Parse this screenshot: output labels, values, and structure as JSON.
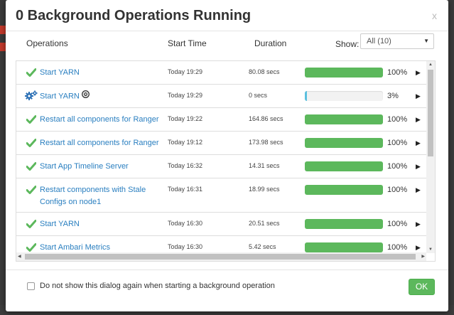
{
  "dialog": {
    "title": "0 Background Operations Running",
    "close_label": "x"
  },
  "columns": {
    "operations": "Operations",
    "start_time": "Start Time",
    "duration": "Duration",
    "show_label": "Show:"
  },
  "show_select": {
    "value": "All (10)"
  },
  "operations": [
    {
      "name": "Start YARN",
      "start": "Today 19:29",
      "duration": "80.08 secs",
      "progress": 100,
      "percent_label": "100%",
      "status": "success",
      "cancellable": false
    },
    {
      "name": "Start YARN",
      "start": "Today 19:29",
      "duration": "0 secs",
      "progress": 3,
      "percent_label": "3%",
      "status": "running",
      "cancellable": true
    },
    {
      "name": "Restart all components for Ranger",
      "start": "Today 19:22",
      "duration": "164.86 secs",
      "progress": 100,
      "percent_label": "100%",
      "status": "success",
      "cancellable": false
    },
    {
      "name": "Restart all components for Ranger",
      "start": "Today 19:12",
      "duration": "173.98 secs",
      "progress": 100,
      "percent_label": "100%",
      "status": "success",
      "cancellable": false
    },
    {
      "name": "Start App Timeline Server",
      "start": "Today 16:32",
      "duration": "14.31 secs",
      "progress": 100,
      "percent_label": "100%",
      "status": "success",
      "cancellable": false
    },
    {
      "name": "Restart components with Stale Configs on node1",
      "start": "Today 16:31",
      "duration": "18.99 secs",
      "progress": 100,
      "percent_label": "100%",
      "status": "success",
      "cancellable": false
    },
    {
      "name": "Start YARN",
      "start": "Today 16:30",
      "duration": "20.51 secs",
      "progress": 100,
      "percent_label": "100%",
      "status": "success",
      "cancellable": false
    },
    {
      "name": "Start Ambari Metrics",
      "start": "Today 16:30",
      "duration": "5.42 secs",
      "progress": 100,
      "percent_label": "100%",
      "status": "success",
      "cancellable": false
    }
  ],
  "footer": {
    "checkbox_label": "Do not show this dialog again when starting a background operation",
    "ok_label": "OK"
  },
  "colors": {
    "success": "#5cb85c",
    "running": "#5bc0de",
    "link": "#2a7fc0",
    "check": "#5cb85c",
    "gear": "#2a6fb5"
  },
  "icons": {
    "success": "check-icon",
    "running": "gears-icon",
    "cancel": "cancel-circle-icon",
    "expand": "caret-right-icon"
  }
}
